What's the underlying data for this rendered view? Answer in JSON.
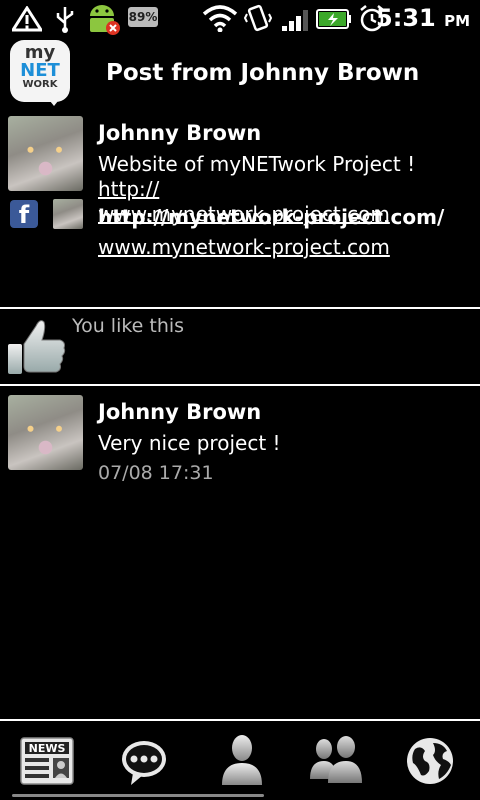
{
  "status_bar": {
    "battery_percent": "89%",
    "time": "5:31",
    "ampm": "PM"
  },
  "header": {
    "logo_text_1": "my",
    "logo_text_2": "NET",
    "logo_text_3": "WORK",
    "title": "Post from Johnny Brown"
  },
  "post": {
    "author": "Johnny Brown",
    "message_prefix": "Website of myNETwork Project ! ",
    "message_link_1": "http://",
    "message_link_2": "www.mynetwork-project.com",
    "link_title": "http://mynetwork-project.com/",
    "link_url": "www.mynetwork-project.com",
    "facebook_glyph": "f"
  },
  "likes": {
    "text": "You  like this"
  },
  "comments": [
    {
      "author": "Johnny Brown",
      "text": "Very nice project !",
      "time": "07/08 17:31"
    }
  ],
  "bottom_nav": {
    "news_label": "NEWS"
  },
  "colors": {
    "background": "#000000",
    "accent": "#1d8fd8",
    "facebook": "#3b5998"
  }
}
